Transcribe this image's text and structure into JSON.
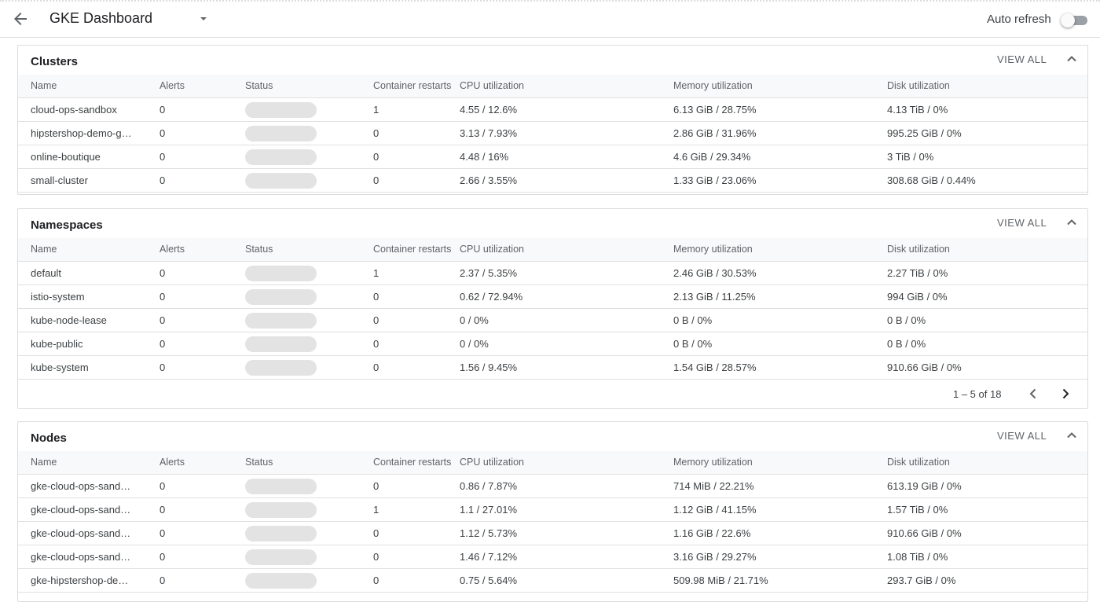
{
  "header": {
    "title": "GKE Dashboard",
    "auto_refresh_label": "Auto refresh",
    "auto_refresh_on": false
  },
  "columns": [
    "Name",
    "Alerts",
    "Status",
    "Container restarts",
    "CPU utilization",
    "Memory utilization",
    "Disk utilization"
  ],
  "clusters": {
    "title": "Clusters",
    "view_all": "VIEW ALL",
    "rows": [
      {
        "name": "cloud-ops-sandbox",
        "alerts": "0",
        "restarts": "1",
        "cpu": "4.55 / 12.6%",
        "memory": "6.13 GiB / 28.75%",
        "disk": "4.13 TiB / 0%"
      },
      {
        "name": "hipstershop-demo-g…",
        "alerts": "0",
        "restarts": "0",
        "cpu": "3.13 / 7.93%",
        "memory": "2.86 GiB / 31.96%",
        "disk": "995.25 GiB / 0%"
      },
      {
        "name": "online-boutique",
        "alerts": "0",
        "restarts": "0",
        "cpu": "4.48 / 16%",
        "memory": "4.6 GiB / 29.34%",
        "disk": "3 TiB / 0%"
      },
      {
        "name": "small-cluster",
        "alerts": "0",
        "restarts": "0",
        "cpu": "2.66 / 3.55%",
        "memory": "1.33 GiB / 23.06%",
        "disk": "308.68 GiB / 0.44%"
      }
    ]
  },
  "namespaces": {
    "title": "Namespaces",
    "view_all": "VIEW ALL",
    "pagination": "1 – 5 of 18",
    "rows": [
      {
        "name": "default",
        "alerts": "0",
        "restarts": "1",
        "cpu": "2.37 / 5.35%",
        "memory": "2.46 GiB / 30.53%",
        "disk": "2.27 TiB / 0%"
      },
      {
        "name": "istio-system",
        "alerts": "0",
        "restarts": "0",
        "cpu": "0.62 / 72.94%",
        "memory": "2.13 GiB / 11.25%",
        "disk": "994 GiB / 0%"
      },
      {
        "name": "kube-node-lease",
        "alerts": "0",
        "restarts": "0",
        "cpu": "0 / 0%",
        "memory": "0 B / 0%",
        "disk": "0 B / 0%"
      },
      {
        "name": "kube-public",
        "alerts": "0",
        "restarts": "0",
        "cpu": "0 / 0%",
        "memory": "0 B / 0%",
        "disk": "0 B / 0%"
      },
      {
        "name": "kube-system",
        "alerts": "0",
        "restarts": "0",
        "cpu": "1.56 / 9.45%",
        "memory": "1.54 GiB / 28.57%",
        "disk": "910.66 GiB / 0%"
      }
    ]
  },
  "nodes": {
    "title": "Nodes",
    "view_all": "VIEW ALL",
    "rows": [
      {
        "name": "gke-cloud-ops-sand…",
        "alerts": "0",
        "restarts": "0",
        "cpu": "0.86 / 7.87%",
        "memory": "714 MiB / 22.21%",
        "disk": "613.19 GiB / 0%"
      },
      {
        "name": "gke-cloud-ops-sand…",
        "alerts": "0",
        "restarts": "1",
        "cpu": "1.1 / 27.01%",
        "memory": "1.12 GiB / 41.15%",
        "disk": "1.57 TiB / 0%"
      },
      {
        "name": "gke-cloud-ops-sand…",
        "alerts": "0",
        "restarts": "0",
        "cpu": "1.12 / 5.73%",
        "memory": "1.16 GiB / 22.6%",
        "disk": "910.66 GiB / 0%"
      },
      {
        "name": "gke-cloud-ops-sand…",
        "alerts": "0",
        "restarts": "0",
        "cpu": "1.46 / 7.12%",
        "memory": "3.16 GiB / 29.27%",
        "disk": "1.08 TiB / 0%"
      },
      {
        "name": "gke-hipstershop-de…",
        "alerts": "0",
        "restarts": "0",
        "cpu": "0.75 / 5.64%",
        "memory": "509.98 MiB / 21.71%",
        "disk": "293.7 GiB / 0%"
      }
    ]
  },
  "icons": {
    "back": "arrow-back-icon",
    "dropdown": "caret-down-icon",
    "collapse": "chevron-up-icon",
    "prev": "chevron-left-icon",
    "next": "chevron-right-icon"
  }
}
